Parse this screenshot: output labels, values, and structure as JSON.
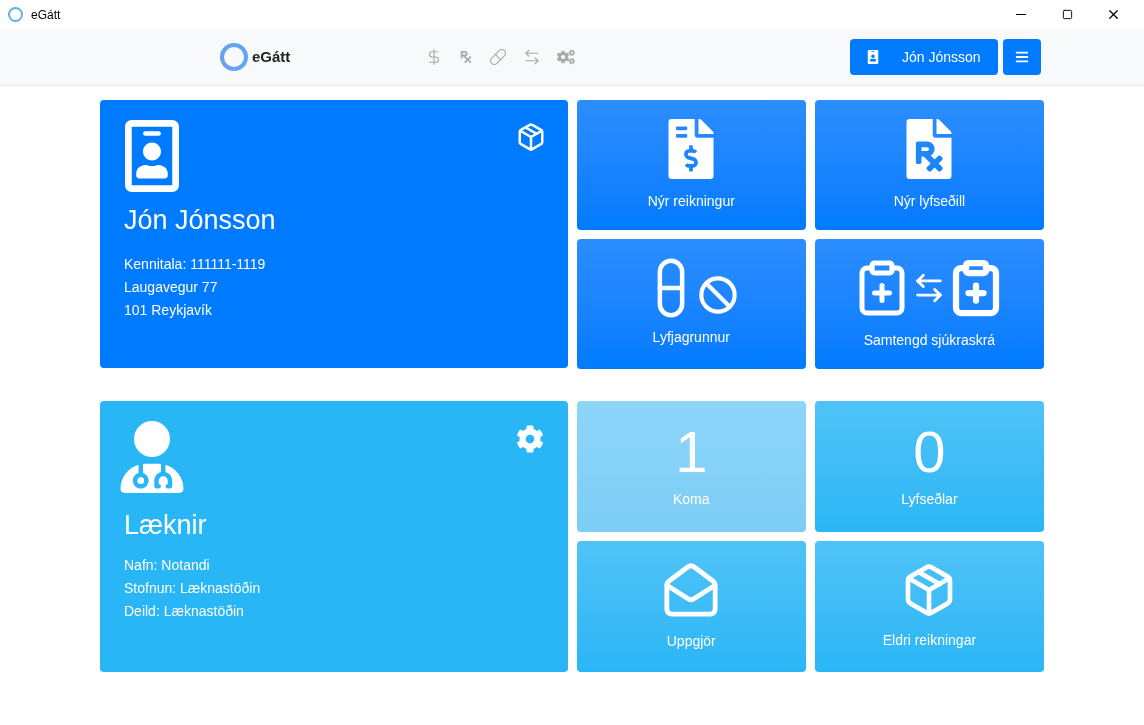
{
  "window": {
    "title": "eGátt"
  },
  "nav": {
    "brand": "eGátt",
    "user_button": "Jón Jónsson"
  },
  "patient": {
    "name": "Jón Jónsson",
    "lines": [
      "Kennitala: 111111-1119",
      "Laugavegur 77",
      "101 Reykjavík"
    ]
  },
  "patient_tiles": [
    {
      "label": "Nýr reikningur"
    },
    {
      "label": "Nýr lyfseðill"
    },
    {
      "label": "Lyfjagrunnur"
    },
    {
      "label": "Samtengd sjúkraskrá"
    }
  ],
  "doctor": {
    "title": "Læknir",
    "lines": [
      "Nafn: Notandi",
      "Stofnun: Læknastöðin",
      "Deild: Læknastöðin"
    ]
  },
  "doctor_tiles": [
    {
      "kind": "count",
      "value": "1",
      "label": "Koma",
      "selected": true
    },
    {
      "kind": "count",
      "value": "0",
      "label": "Lyfseðlar",
      "selected": false
    },
    {
      "kind": "icon",
      "label": "Uppgjör",
      "selected": false
    },
    {
      "kind": "icon",
      "label": "Eldri reikningar",
      "selected": false
    }
  ]
}
